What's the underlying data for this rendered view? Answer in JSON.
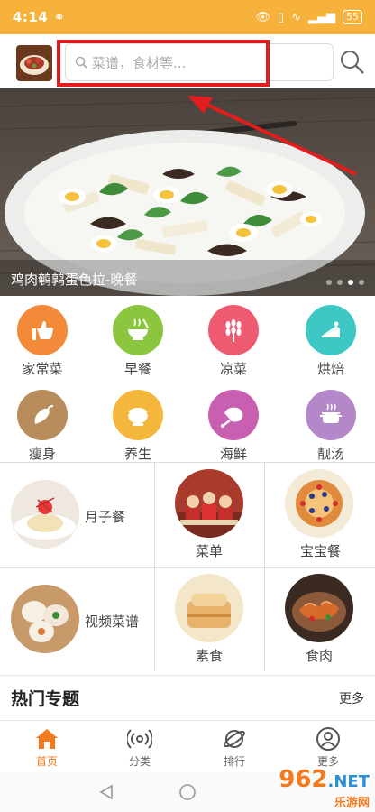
{
  "statusbar": {
    "time": "4:14",
    "battery": "55"
  },
  "search": {
    "placeholder": "菜谱，食材等..."
  },
  "banner": {
    "caption": "鸡肉鹌鹑蛋色拉-晚餐",
    "dots": 4,
    "active_dot": 2
  },
  "categories": [
    {
      "label": "家常菜",
      "color": "#f28a3a",
      "icon": "thumbs-up-icon"
    },
    {
      "label": "早餐",
      "color": "#8cc63f",
      "icon": "bowl-icon"
    },
    {
      "label": "凉菜",
      "color": "#ee5a6f",
      "icon": "wheat-icon"
    },
    {
      "label": "烘焙",
      "color": "#3dc8c5",
      "icon": "cake-icon"
    },
    {
      "label": "瘦身",
      "color": "#b98c5c",
      "icon": "pepper-icon"
    },
    {
      "label": "养生",
      "color": "#f5b73b",
      "icon": "rice-bowl-icon"
    },
    {
      "label": "海鲜",
      "color": "#c85fb0",
      "icon": "ham-icon"
    },
    {
      "label": "靓汤",
      "color": "#b487c8",
      "icon": "soup-pot-icon"
    }
  ],
  "features": [
    {
      "label": "月子餐"
    },
    {
      "label": "菜单"
    },
    {
      "label": "宝宝餐"
    },
    {
      "label": "视频菜谱"
    },
    {
      "label": "素食"
    },
    {
      "label": "食肉"
    }
  ],
  "hot": {
    "title": "热门专题",
    "more": "更多"
  },
  "tabs": [
    {
      "label": "首页"
    },
    {
      "label": "分类"
    },
    {
      "label": "排行"
    },
    {
      "label": "更多"
    }
  ],
  "watermark": {
    "brand": "962",
    "suffix": ".NET",
    "sub": "乐游网"
  }
}
